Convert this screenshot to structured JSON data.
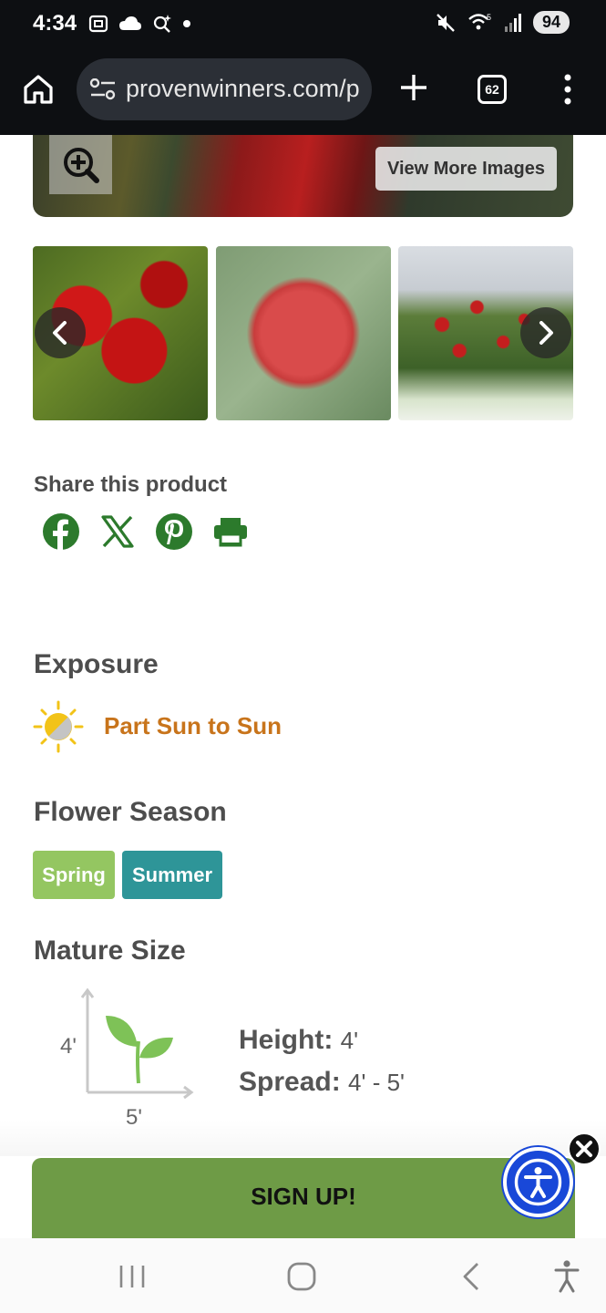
{
  "status_bar": {
    "time": "4:34",
    "battery": "94",
    "network_label": "5"
  },
  "browser": {
    "url": "provenwinners.com/p",
    "tab_count": "62"
  },
  "gallery": {
    "view_more_label": "View More Images",
    "thumbnails": [
      "red hibiscus cluster",
      "red hibiscus close-up",
      "hibiscus in garden"
    ]
  },
  "share": {
    "title": "Share this product",
    "icons": [
      "facebook-icon",
      "x-icon",
      "pinterest-icon",
      "print-icon"
    ]
  },
  "exposure": {
    "title": "Exposure",
    "value": "Part Sun to Sun"
  },
  "flower_season": {
    "title": "Flower Season",
    "tags": [
      "Spring",
      "Summer"
    ]
  },
  "mature_size": {
    "title": "Mature Size",
    "diagram_height": "4'",
    "diagram_spread": "5'",
    "height_label": "Height:",
    "height_value": "4'",
    "spread_label": "Spread:",
    "spread_value": "4' - 5'"
  },
  "signup": {
    "label": "SIGN UP!"
  },
  "colors": {
    "brand_green": "#6e9b46",
    "exposure_orange": "#c8741b",
    "spring_tag": "#94c661",
    "summer_tag": "#2e9598",
    "share_icon_green": "#2c7a2c",
    "accessibility_blue": "#1948d8"
  }
}
